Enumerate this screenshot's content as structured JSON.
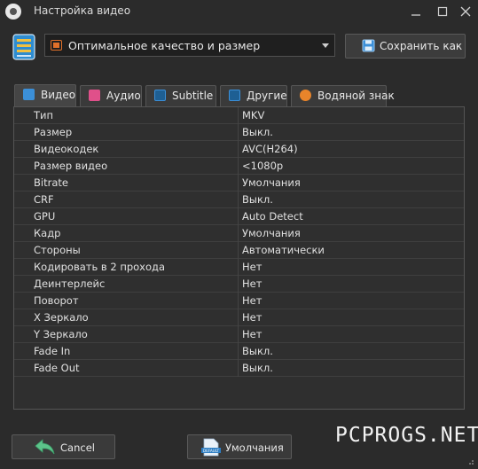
{
  "window": {
    "title": "Настройка видео"
  },
  "profile": {
    "selected": "Оптимальное качество и размер",
    "save_as_label": "Сохранить как"
  },
  "tabs": [
    {
      "label": "Видео",
      "icon": "film-icon",
      "color": "#3b8fd8"
    },
    {
      "label": "Аудио",
      "icon": "music-note-icon",
      "color": "#e0508a"
    },
    {
      "label": "Subtitle",
      "icon": "subtitle-icon",
      "color": "#3b8fd8"
    },
    {
      "label": "Другие",
      "icon": "other-settings-icon",
      "color": "#3b8fd8"
    },
    {
      "label": "Водяной знак",
      "icon": "watermark-icon",
      "color": "#e8842a"
    }
  ],
  "properties": [
    {
      "name": "Тип",
      "value": "MKV"
    },
    {
      "name": "Размер",
      "value": "Выкл."
    },
    {
      "name": "Видеокодек",
      "value": "AVC(H264)"
    },
    {
      "name": "Размер видео",
      "value": "<1080p"
    },
    {
      "name": "Bitrate",
      "value": "Умолчания"
    },
    {
      "name": "CRF",
      "value": "Выкл."
    },
    {
      "name": "GPU",
      "value": "Auto Detect"
    },
    {
      "name": "Кадр",
      "value": "Умолчания"
    },
    {
      "name": "Стороны",
      "value": "Автоматически"
    },
    {
      "name": "Кодировать в 2 прохода",
      "value": "Нет"
    },
    {
      "name": "Деинтерлейс",
      "value": "Нет"
    },
    {
      "name": "Поворот",
      "value": "Нет"
    },
    {
      "name": "X Зеркало",
      "value": "Нет"
    },
    {
      "name": "Y Зеркало",
      "value": "Нет"
    },
    {
      "name": "Fade In",
      "value": "Выкл."
    },
    {
      "name": "Fade Out",
      "value": "Выкл."
    }
  ],
  "footer": {
    "cancel_label": "Cancel",
    "defaults_label": "Умолчания",
    "defaults_icon_text": "DEFAULT"
  },
  "watermark_text": "PCPROGS.NET"
}
